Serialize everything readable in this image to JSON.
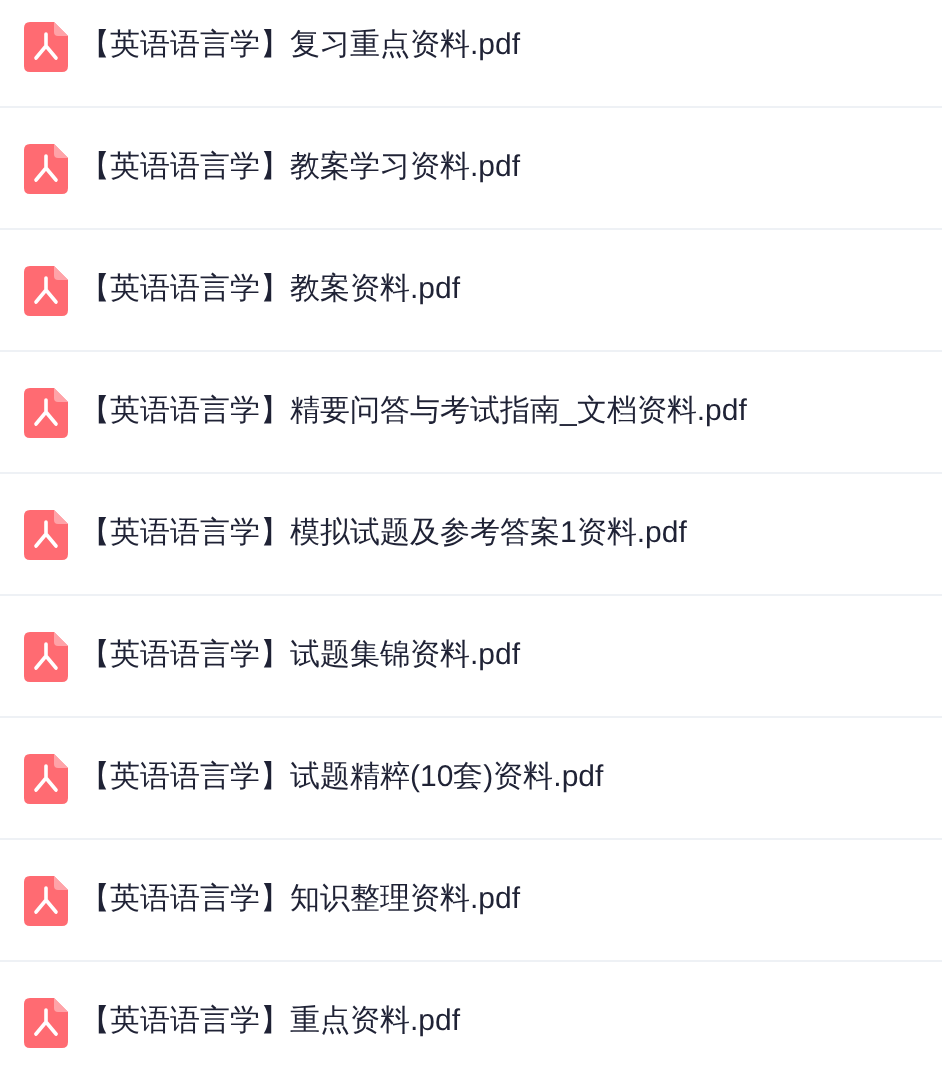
{
  "files": [
    {
      "name": "【英语语言学】复习重点资料.pdf"
    },
    {
      "name": "【英语语言学】教案学习资料.pdf"
    },
    {
      "name": "【英语语言学】教案资料.pdf"
    },
    {
      "name": "【英语语言学】精要问答与考试指南_文档资料.pdf"
    },
    {
      "name": "【英语语言学】模拟试题及参考答案1资料.pdf"
    },
    {
      "name": "【英语语言学】试题集锦资料.pdf"
    },
    {
      "name": "【英语语言学】试题精粹(10套)资料.pdf"
    },
    {
      "name": "【英语语言学】知识整理资料.pdf"
    },
    {
      "name": "【英语语言学】重点资料.pdf"
    }
  ]
}
